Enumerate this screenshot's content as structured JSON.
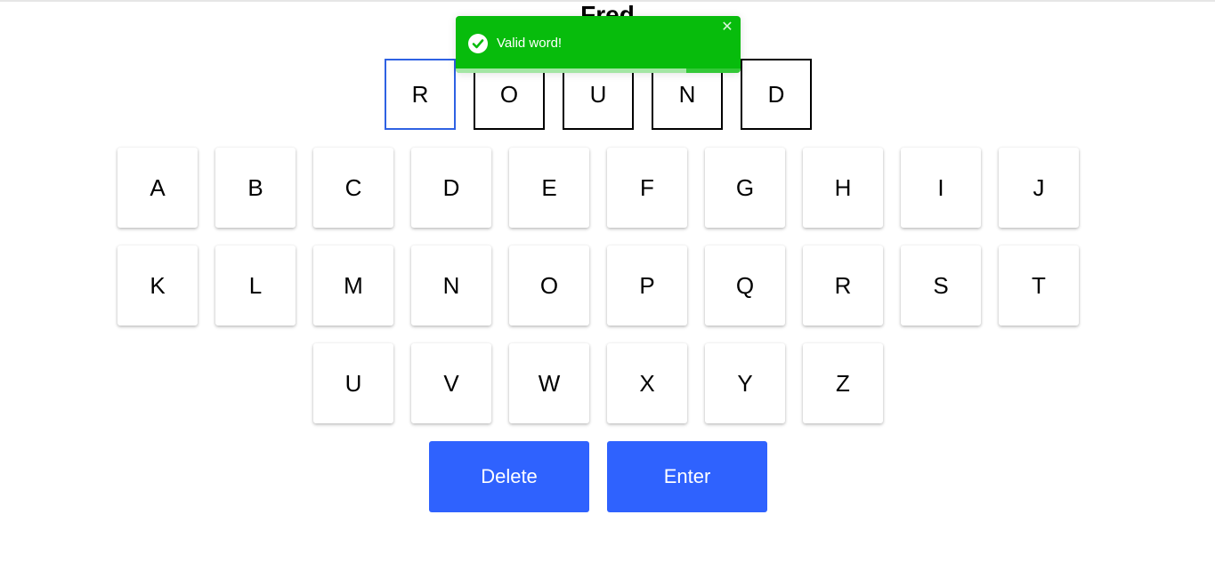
{
  "title": "Fred",
  "current_word": {
    "letters": [
      "R",
      "O",
      "U",
      "N",
      "D"
    ],
    "active_index": 0
  },
  "keyboard": {
    "row1": [
      "A",
      "B",
      "C",
      "D",
      "E",
      "F",
      "G",
      "H",
      "I",
      "J"
    ],
    "row2": [
      "K",
      "L",
      "M",
      "N",
      "O",
      "P",
      "Q",
      "R",
      "S",
      "T"
    ],
    "row3": [
      "U",
      "V",
      "W",
      "X",
      "Y",
      "Z"
    ]
  },
  "actions": {
    "delete_label": "Delete",
    "enter_label": "Enter"
  },
  "toast": {
    "message": "Valid word!",
    "icon": "check-circle-icon",
    "close_glyph": "✕",
    "progress_fraction": 0.81,
    "color": "#07bc0c"
  },
  "colors": {
    "accent": "#2f62fe",
    "active_slot_border": "#2f62e3",
    "success": "#07bc0c"
  }
}
